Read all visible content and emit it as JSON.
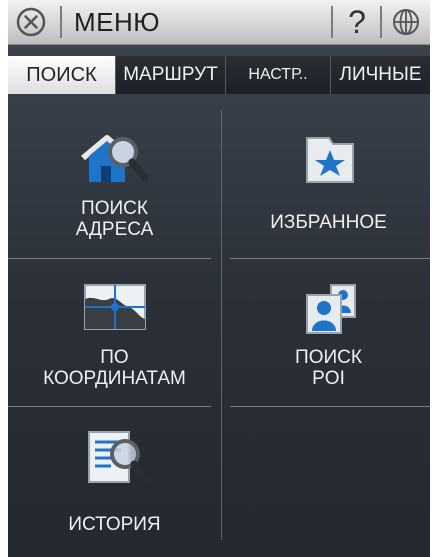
{
  "header": {
    "title": "МЕНЮ",
    "close_icon": "close-circle-icon",
    "help_label": "?",
    "globe_icon": "globe-icon"
  },
  "tabs": [
    {
      "label": "ПОИСК",
      "active": true
    },
    {
      "label": "МАРШРУТ",
      "active": false
    },
    {
      "label": "НАСТР..",
      "active": false
    },
    {
      "label": "ЛИЧНЫЕ",
      "active": false
    }
  ],
  "menu": {
    "address_search": {
      "label": "ПОИСК\nАДРЕСА",
      "icon": "house-magnifier-icon"
    },
    "favorites": {
      "label": "ИЗБРАННОЕ",
      "icon": "star-folder-icon"
    },
    "by_coordinates": {
      "label": "ПО\nКООРДИНАТАМ",
      "icon": "map-crosshair-icon"
    },
    "poi_search": {
      "label": "ПОИСК\nPOI",
      "icon": "poi-people-icon"
    },
    "history": {
      "label": "ИСТОРИЯ",
      "icon": "list-magnifier-icon"
    }
  },
  "colors": {
    "background": "#2b3038",
    "titlebar": "#d9d9d9",
    "active_tab": "#ffffff",
    "accent_blue": "#1e74c8"
  }
}
